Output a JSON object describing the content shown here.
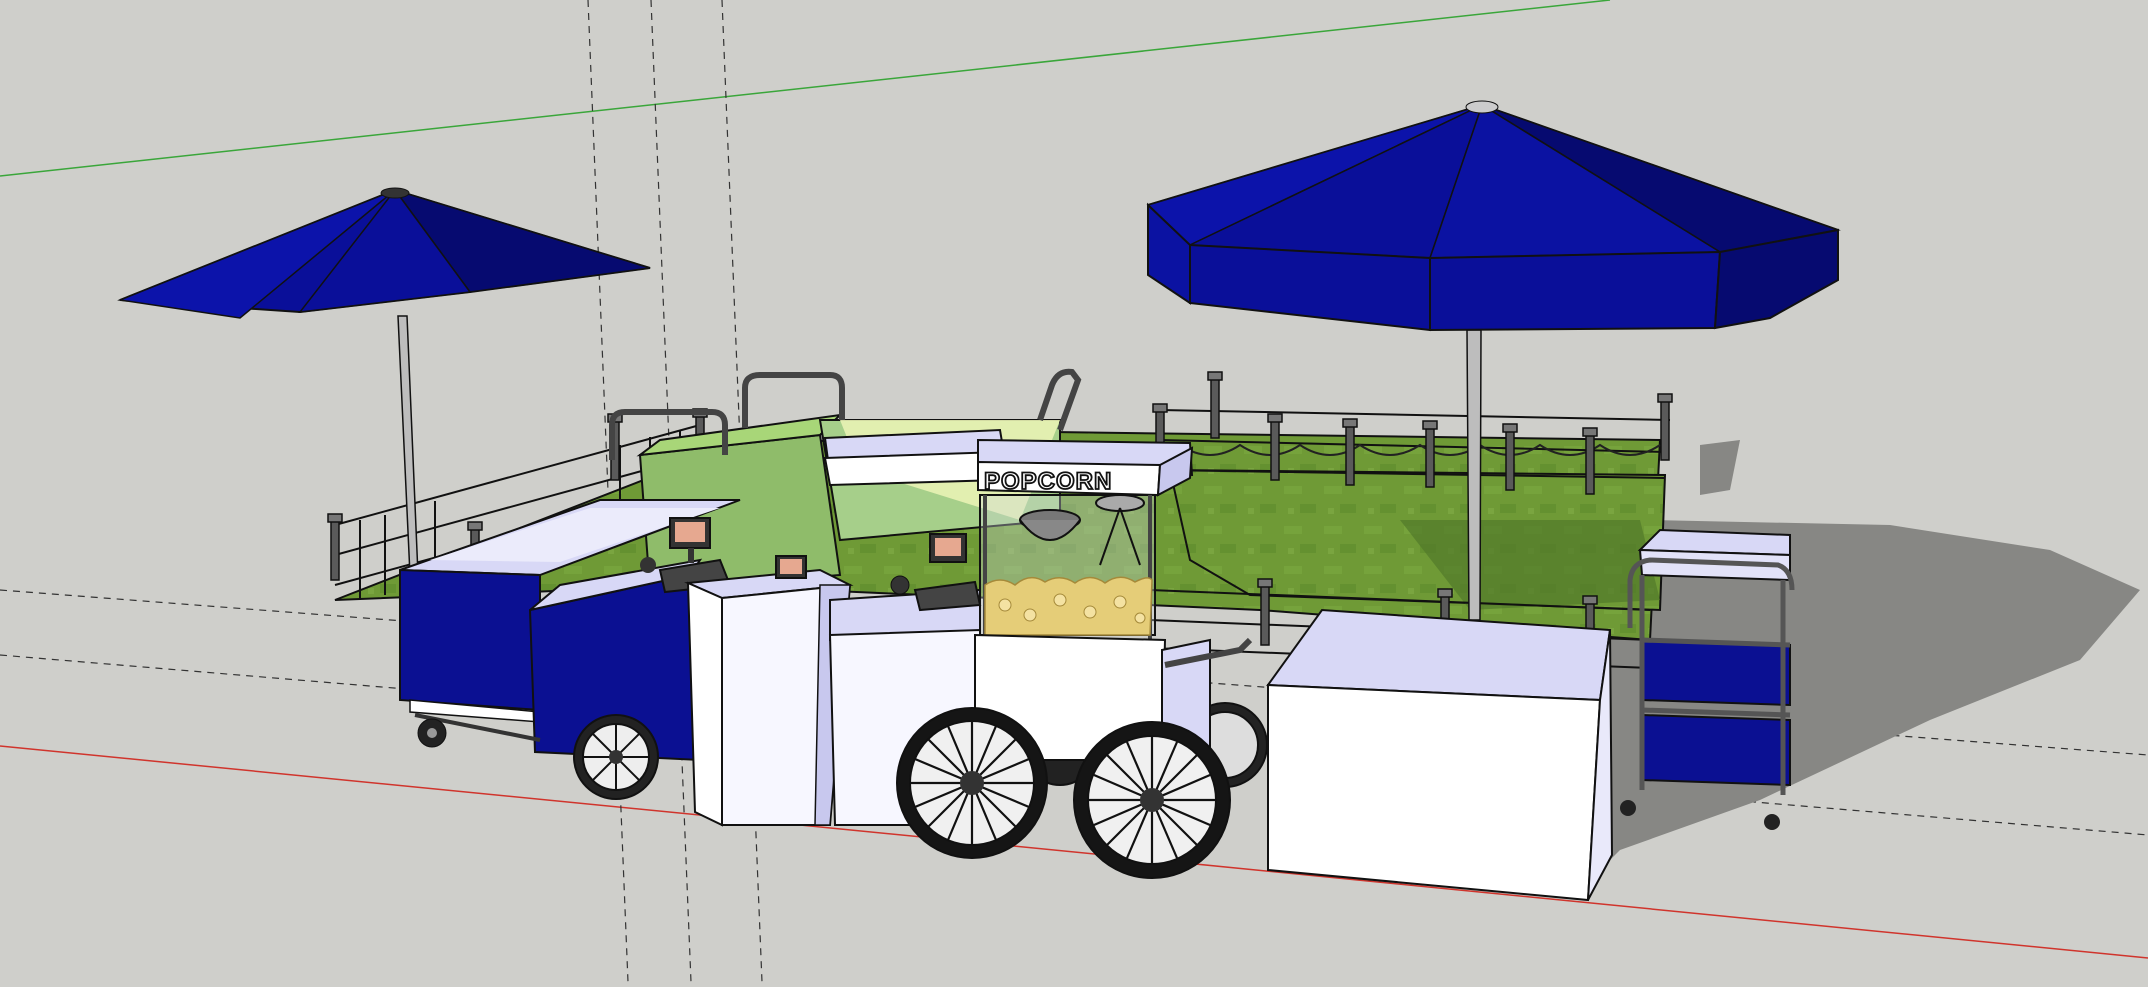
{
  "scene": {
    "popcorn_sign": "POPCORN",
    "colors": {
      "background": "#cfcfcb",
      "umbrella_blue": "#0a0f99",
      "umbrella_dark": "#060a70",
      "grass": "#6f9a36",
      "grass_dark": "#5d8a2b",
      "cart_blue": "#0b1092",
      "cart_white": "#f7f7ff",
      "shadow": "#878784",
      "axis_red": "#d0342c",
      "axis_green": "#3aa63a",
      "lavender": "#d8d8f6",
      "light_green": "#a8d678",
      "popcorn": "#e5cd78"
    },
    "icons": [
      "umbrella-icon",
      "wagon-wheel-icon",
      "cash-register-icon",
      "railing-icon"
    ]
  }
}
